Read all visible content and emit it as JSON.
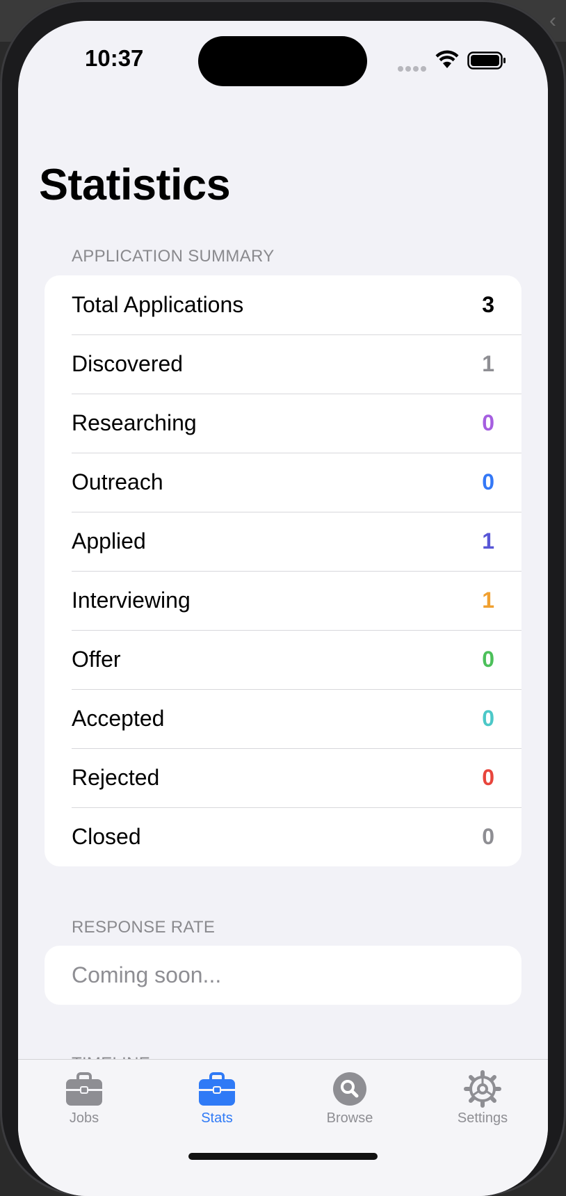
{
  "status_bar": {
    "time": "10:37"
  },
  "page": {
    "title": "Statistics"
  },
  "summary": {
    "header": "APPLICATION SUMMARY",
    "rows": [
      {
        "label": "Total Applications",
        "value": "3",
        "color": "#000000"
      },
      {
        "label": "Discovered",
        "value": "1",
        "color": "#8e8e93"
      },
      {
        "label": "Researching",
        "value": "0",
        "color": "#a55ee0"
      },
      {
        "label": "Outreach",
        "value": "0",
        "color": "#3478f6"
      },
      {
        "label": "Applied",
        "value": "1",
        "color": "#5856d6"
      },
      {
        "label": "Interviewing",
        "value": "1",
        "color": "#f0a030"
      },
      {
        "label": "Offer",
        "value": "0",
        "color": "#4cc05a"
      },
      {
        "label": "Accepted",
        "value": "0",
        "color": "#4cc8c8"
      },
      {
        "label": "Rejected",
        "value": "0",
        "color": "#e8453c"
      },
      {
        "label": "Closed",
        "value": "0",
        "color": "#8e8e93"
      }
    ]
  },
  "response_rate": {
    "header": "RESPONSE RATE",
    "placeholder": "Coming soon..."
  },
  "timeline": {
    "header": "TIMELINE"
  },
  "tab_bar": {
    "tabs": [
      {
        "label": "Jobs",
        "icon": "briefcase-icon"
      },
      {
        "label": "Stats",
        "icon": "briefcase-icon",
        "active": true
      },
      {
        "label": "Browse",
        "icon": "magnifier-circle-icon"
      },
      {
        "label": "Settings",
        "icon": "gear-icon"
      }
    ],
    "active_color": "#2f7af6",
    "inactive_color": "#8e8e93"
  }
}
